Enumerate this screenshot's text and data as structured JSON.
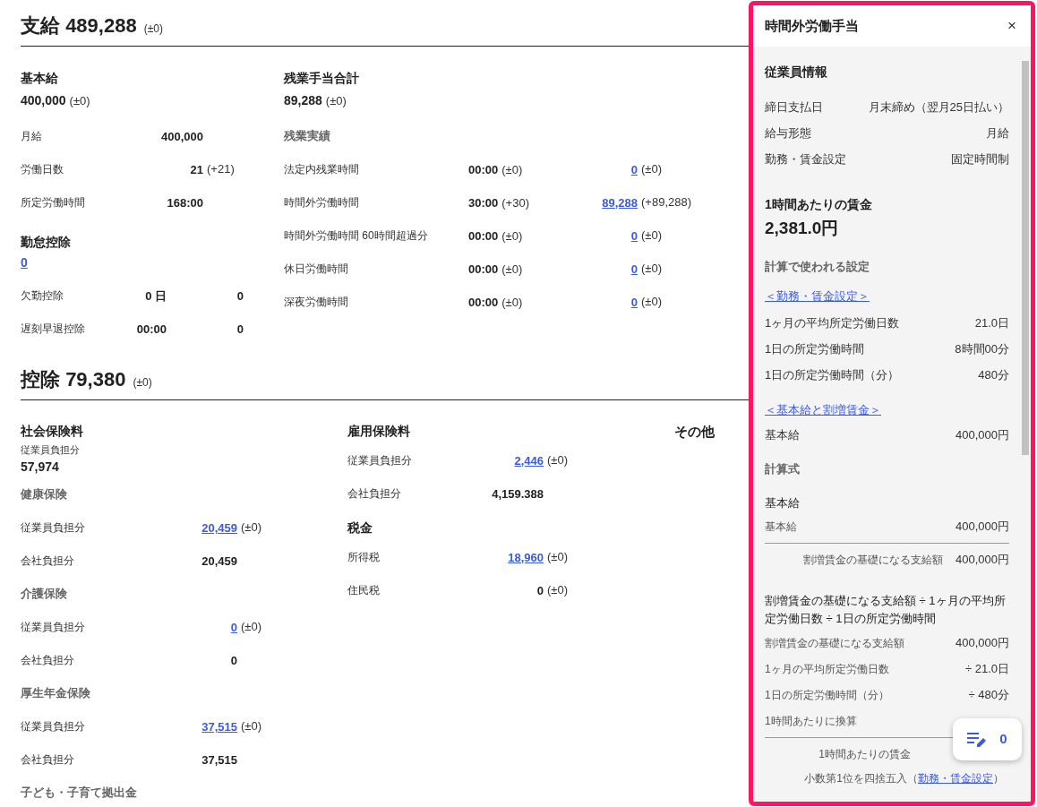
{
  "payments": {
    "title": "支給",
    "total": "489,288",
    "diff": "(±0)",
    "basic_pay": {
      "title": "基本給",
      "amount": "400,000",
      "diff": "(±0)",
      "rows": [
        {
          "label": "月給",
          "value": "400,000"
        },
        {
          "label": "労働日数",
          "value": "21",
          "diff": "(+21)"
        },
        {
          "label": "所定労働時間",
          "value": "168:00"
        }
      ]
    },
    "absence_deduction": {
      "title": "勤怠控除",
      "amount": "0",
      "rows": [
        {
          "label": "欠勤控除",
          "value": "0 日",
          "amount": "0"
        },
        {
          "label": "遅刻早退控除",
          "value": "00:00",
          "amount": "0"
        }
      ]
    },
    "overtime": {
      "title": "残業手当合計",
      "amount": "89,288",
      "diff": "(±0)",
      "subtitle": "残業実績",
      "rows": [
        {
          "label": "法定内残業時間",
          "time": "00:00",
          "time_diff": "(±0)",
          "amount": "0",
          "amount_diff": "(±0)"
        },
        {
          "label": "時間外労働時間",
          "time": "30:00",
          "time_diff": "(+30)",
          "amount": "89,288",
          "amount_diff": "(+89,288)"
        },
        {
          "label": "時間外労働時間 60時間超過分",
          "time": "00:00",
          "time_diff": "(±0)",
          "amount": "0",
          "amount_diff": "(±0)"
        },
        {
          "label": "休日労働時間",
          "time": "00:00",
          "time_diff": "(±0)",
          "amount": "0",
          "amount_diff": "(±0)"
        },
        {
          "label": "深夜労働時間",
          "time": "00:00",
          "time_diff": "(±0)",
          "amount": "0",
          "amount_diff": "(±0)"
        }
      ]
    }
  },
  "deductions": {
    "title": "控除",
    "total": "79,380",
    "diff": "(±0)",
    "social_insurance": {
      "title": "社会保険料",
      "employee_label": "従業員負担分",
      "employee_amount": "57,974",
      "groups": [
        {
          "title": "健康保険",
          "rows": [
            {
              "label": "従業員負担分",
              "value": "20,459",
              "diff": "(±0)",
              "link": true
            },
            {
              "label": "会社負担分",
              "value": "20,459",
              "link": false
            }
          ]
        },
        {
          "title": "介護保険",
          "rows": [
            {
              "label": "従業員負担分",
              "value": "0",
              "diff": "(±0)",
              "link": true
            },
            {
              "label": "会社負担分",
              "value": "0",
              "link": false
            }
          ]
        },
        {
          "title": "厚生年金保険",
          "rows": [
            {
              "label": "従業員負担分",
              "value": "37,515",
              "diff": "(±0)",
              "link": true
            },
            {
              "label": "会社負担分",
              "value": "37,515",
              "link": false
            }
          ]
        },
        {
          "title": "子ども・子育て拠出金"
        }
      ]
    },
    "employment_insurance": {
      "title": "雇用保険料",
      "rows": [
        {
          "label": "従業員負担分",
          "value": "2,446",
          "diff": "(±0)",
          "link": true
        },
        {
          "label": "会社負担分",
          "value": "4,159.388",
          "link": false
        }
      ]
    },
    "taxes": {
      "title": "税金",
      "rows": [
        {
          "label": "所得税",
          "value": "18,960",
          "diff": "(±0)",
          "link": true
        },
        {
          "label": "住民税",
          "value": "0",
          "diff": "(±0)",
          "link": false
        }
      ]
    },
    "other": {
      "title": "その他"
    }
  },
  "panel": {
    "title": "時間外労働手当",
    "close": "×",
    "employee_info": {
      "title": "従業員情報",
      "rows": [
        {
          "label": "締日支払日",
          "value": "月末締め（翌月25日払い）"
        },
        {
          "label": "給与形態",
          "value": "月給"
        },
        {
          "label": "勤務・賃金設定",
          "value": "固定時間制"
        }
      ]
    },
    "hourly_wage": {
      "title": "1時間あたりの賃金",
      "amount": "2,381.0円"
    },
    "settings_title": "計算で使われる設定",
    "work_settings": {
      "link": "＜勤務・賃金設定＞",
      "rows": [
        {
          "label": "1ヶ月の平均所定労働日数",
          "value": "21.0日"
        },
        {
          "label": "1日の所定労働時間",
          "value": "8時間00分"
        },
        {
          "label": "1日の所定労働時間（分）",
          "value": "480分"
        }
      ]
    },
    "base_settings": {
      "link": "＜基本給と割増賃金＞",
      "rows": [
        {
          "label": "基本給",
          "value": "400,000円"
        }
      ]
    },
    "formula_title": "計算式",
    "base_formula": {
      "title": "基本給",
      "rows": [
        {
          "label": "基本給",
          "value": "400,000円"
        }
      ],
      "total_label": "割増賃金の基礎になる支給額",
      "total_value": "400,000円"
    },
    "wage_formula": {
      "title": "割増賃金の基礎になる支給額 ÷ 1ヶ月の平均所定労働日数 ÷ 1日の所定労働時間",
      "rows": [
        {
          "label": "割増賃金の基礎になる支給額",
          "value": "400,000円"
        },
        {
          "label": "1ヶ月の平均所定労働日数",
          "value": "÷ 21.0日"
        },
        {
          "label": "1日の所定労働時間（分）",
          "value": "÷ 480分"
        },
        {
          "label": "1時間あたりに換算"
        }
      ],
      "total_label": "1時間あたりの賃金"
    },
    "note": "小数第1位を四捨五入（",
    "note_link": "勤務・賃金設定",
    "note_end": "）",
    "memo_count": "0"
  }
}
